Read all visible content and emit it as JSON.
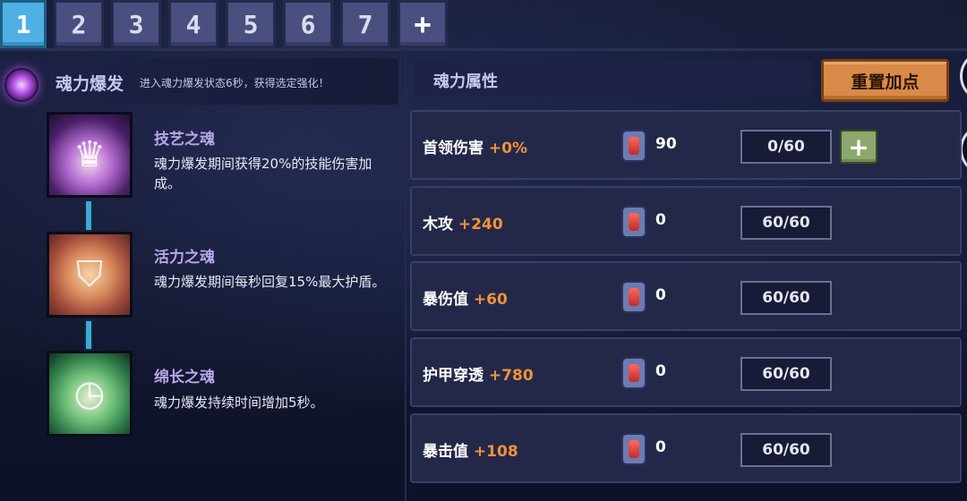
{
  "tabs": [
    "1",
    "2",
    "3",
    "4",
    "5",
    "6",
    "7",
    "+"
  ],
  "burst": {
    "title": "魂力爆发",
    "desc": "进入魂力爆发状态6秒，获得选定强化！"
  },
  "souls": [
    {
      "name": "技艺之魂",
      "desc": "魂力爆发期间获得20%的技能伤害加成。"
    },
    {
      "name": "活力之魂",
      "desc": "魂力爆发期间每秒回复15%最大护盾。"
    },
    {
      "name": "绵长之魂",
      "desc": "魂力爆发持续时间增加5秒。"
    }
  ],
  "attributes": {
    "title": "魂力属性",
    "reset_label": "重置加点",
    "rows": [
      {
        "name": "首领伤害",
        "bonus": "+0%",
        "cost": "90",
        "level": "0/60",
        "add": "+"
      },
      {
        "name": "木攻",
        "bonus": "+240",
        "cost": "0",
        "level": "60/60"
      },
      {
        "name": "暴伤值",
        "bonus": "+60",
        "cost": "0",
        "level": "60/60"
      },
      {
        "name": "护甲穿透",
        "bonus": "+780",
        "cost": "0",
        "level": "60/60"
      },
      {
        "name": "暴击值",
        "bonus": "+108",
        "cost": "0",
        "level": "60/60"
      }
    ]
  },
  "colors": {
    "accent_orange": "#f0923a",
    "tab_active": "#4fb0e4",
    "reset_button": "#d98a48",
    "add_button": "#8da86c"
  }
}
